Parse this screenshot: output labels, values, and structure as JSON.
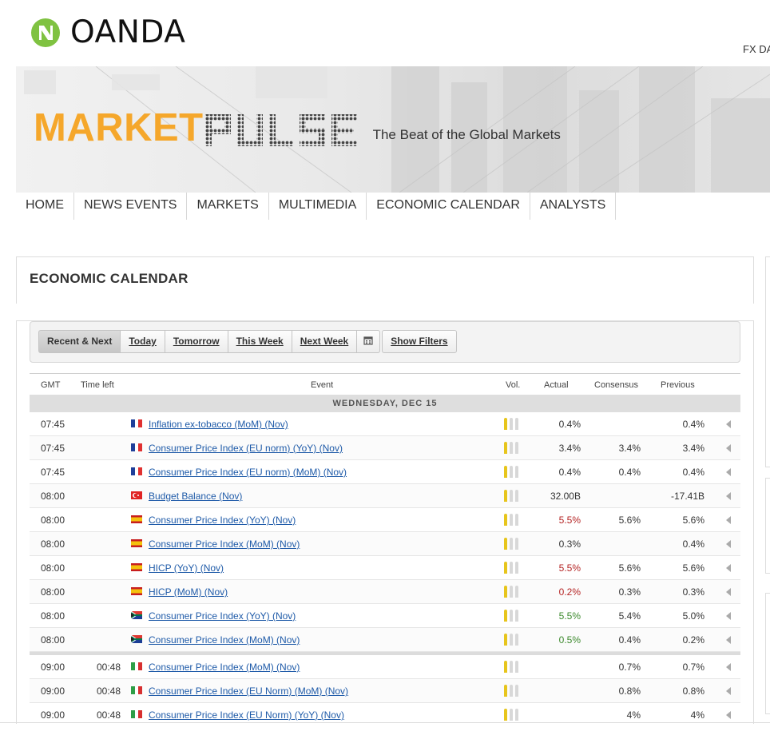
{
  "header": {
    "logo_text": "OANDA",
    "fx_link": "FX DA"
  },
  "banner": {
    "brand_market": "MARKET",
    "brand_pulse": "PULSE",
    "tagline": "The Beat of the Global Markets"
  },
  "nav": [
    {
      "label": "HOME"
    },
    {
      "label": "NEWS EVENTS"
    },
    {
      "label": "MARKETS"
    },
    {
      "label": "MULTIMEDIA"
    },
    {
      "label": "ECONOMIC CALENDAR"
    },
    {
      "label": "ANALYSTS"
    }
  ],
  "section_title": "ECONOMIC CALENDAR",
  "filters": {
    "recent_next": "Recent & Next",
    "today": "Today",
    "tomorrow": "Tomorrow",
    "this_week": "This Week",
    "next_week": "Next Week",
    "show_filters": "Show Filters",
    "calendar_icon": "calendar-icon"
  },
  "table": {
    "headers": {
      "gmt": "GMT",
      "time_left": "Time left",
      "event": "Event",
      "vol": "Vol.",
      "actual": "Actual",
      "consensus": "Consensus",
      "previous": "Previous"
    },
    "day_label": "WEDNESDAY, DEC 15",
    "rows_group1": [
      {
        "gmt": "07:45",
        "time_left": "",
        "flag": "fr",
        "event": "Inflation ex-tobacco (MoM) (Nov)",
        "actual": "0.4%",
        "actual_color": "",
        "consensus": "",
        "previous": "0.4%"
      },
      {
        "gmt": "07:45",
        "time_left": "",
        "flag": "fr",
        "event": "Consumer Price Index (EU norm) (YoY) (Nov)",
        "actual": "3.4%",
        "actual_color": "",
        "consensus": "3.4%",
        "previous": "3.4%"
      },
      {
        "gmt": "07:45",
        "time_left": "",
        "flag": "fr",
        "event": "Consumer Price Index (EU norm) (MoM) (Nov)",
        "actual": "0.4%",
        "actual_color": "",
        "consensus": "0.4%",
        "previous": "0.4%"
      },
      {
        "gmt": "08:00",
        "time_left": "",
        "flag": "tr",
        "event": "Budget Balance (Nov)",
        "actual": "32.00B",
        "actual_color": "",
        "consensus": "",
        "previous": "-17.41B"
      },
      {
        "gmt": "08:00",
        "time_left": "",
        "flag": "es",
        "event": "Consumer Price Index (YoY) (Nov)",
        "actual": "5.5%",
        "actual_color": "red",
        "consensus": "5.6%",
        "previous": "5.6%"
      },
      {
        "gmt": "08:00",
        "time_left": "",
        "flag": "es",
        "event": "Consumer Price Index (MoM) (Nov)",
        "actual": "0.3%",
        "actual_color": "",
        "consensus": "",
        "previous": "0.4%"
      },
      {
        "gmt": "08:00",
        "time_left": "",
        "flag": "es",
        "event": "HICP (YoY) (Nov)",
        "actual": "5.5%",
        "actual_color": "red",
        "consensus": "5.6%",
        "previous": "5.6%"
      },
      {
        "gmt": "08:00",
        "time_left": "",
        "flag": "es",
        "event": "HICP (MoM) (Nov)",
        "actual": "0.2%",
        "actual_color": "red",
        "consensus": "0.3%",
        "previous": "0.3%"
      },
      {
        "gmt": "08:00",
        "time_left": "",
        "flag": "za",
        "event": "Consumer Price Index (YoY) (Nov)",
        "actual": "5.5%",
        "actual_color": "green",
        "consensus": "5.4%",
        "previous": "5.0%"
      },
      {
        "gmt": "08:00",
        "time_left": "",
        "flag": "za",
        "event": "Consumer Price Index (MoM) (Nov)",
        "actual": "0.5%",
        "actual_color": "green",
        "consensus": "0.4%",
        "previous": "0.2%"
      }
    ],
    "rows_group2": [
      {
        "gmt": "09:00",
        "time_left": "00:48",
        "flag": "it",
        "event": "Consumer Price Index (MoM) (Nov)",
        "actual": "",
        "actual_color": "",
        "consensus": "0.7%",
        "previous": "0.7%"
      },
      {
        "gmt": "09:00",
        "time_left": "00:48",
        "flag": "it",
        "event": "Consumer Price Index (EU Norm) (MoM) (Nov)",
        "actual": "",
        "actual_color": "",
        "consensus": "0.8%",
        "previous": "0.8%"
      },
      {
        "gmt": "09:00",
        "time_left": "00:48",
        "flag": "it",
        "event": "Consumer Price Index (EU Norm) (YoY) (Nov)",
        "actual": "",
        "actual_color": "",
        "consensus": "4%",
        "previous": "4%"
      }
    ],
    "volatility_level": 1,
    "colors": {
      "red": "#b52525",
      "green": "#3d8a2e",
      "link": "#1e5aa8",
      "accent": "#f5a72b"
    }
  }
}
